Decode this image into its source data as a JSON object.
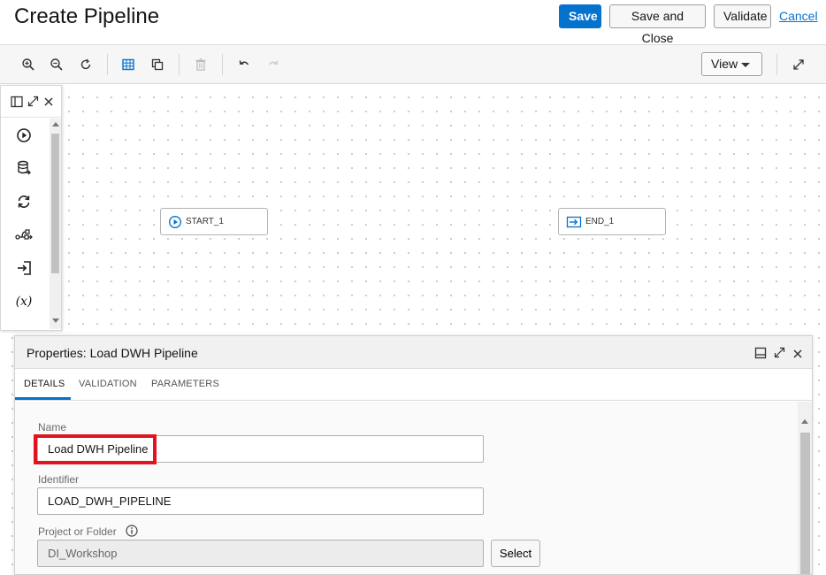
{
  "header": {
    "title": "Create Pipeline",
    "save_label": "Save",
    "save_close_label": "Save and Close",
    "validate_label": "Validate",
    "cancel_label": "Cancel"
  },
  "toolbar": {
    "view_label": "View",
    "icons": [
      "zoom-in-icon",
      "zoom-out-icon",
      "reset-zoom-icon",
      "grid-icon",
      "copy-icon",
      "delete-icon",
      "undo-icon",
      "redo-icon",
      "expand-icon"
    ]
  },
  "palette": {
    "items": [
      "start-icon",
      "data-loader-icon",
      "refresh-icon",
      "integration-icon",
      "end-icon",
      "expression-icon"
    ],
    "expression_glyph": "(x)"
  },
  "canvas": {
    "nodes": [
      {
        "label": "START_1"
      },
      {
        "label": "END_1"
      }
    ]
  },
  "properties": {
    "title": "Properties: Load DWH Pipeline",
    "tabs": [
      "DETAILS",
      "VALIDATION",
      "PARAMETERS"
    ],
    "active_tab": "DETAILS",
    "fields": {
      "name_label": "Name",
      "name_value": "Load DWH Pipeline",
      "identifier_label": "Identifier",
      "identifier_value": "LOAD_DWH_PIPELINE",
      "project_label": "Project or Folder",
      "project_value": "DI_Workshop",
      "select_label": "Select"
    }
  },
  "colors": {
    "accent": "#0572ce",
    "highlight": "#e0131e"
  }
}
